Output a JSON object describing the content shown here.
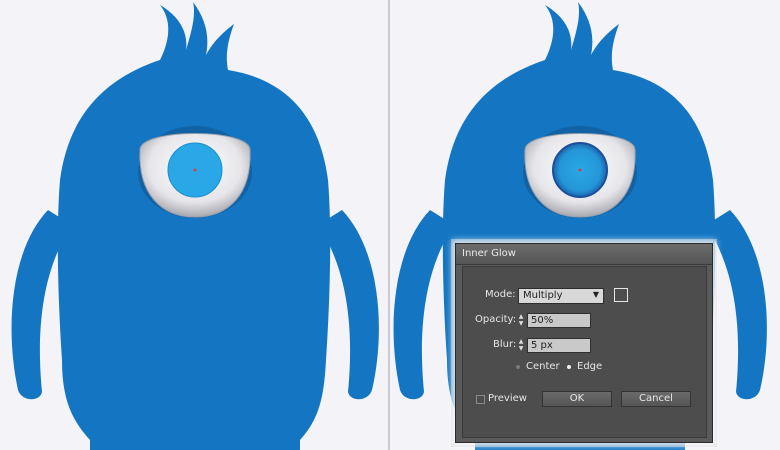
{
  "dialog": {
    "title": "Inner Glow",
    "mode_label": "Mode:",
    "mode_value": "Multiply",
    "opacity_label": "Opacity:",
    "opacity_value": "50%",
    "blur_label": "Blur:",
    "blur_value": "5 px",
    "center_label": "Center",
    "edge_label": "Edge",
    "selected_option": "Edge",
    "preview_label": "Preview",
    "preview_checked": false,
    "ok_label": "OK",
    "cancel_label": "Cancel"
  },
  "colors": {
    "monster_blue": "#1476c2",
    "eye_white": "#eeeeee",
    "iris": "#2aa7e6",
    "iris_stroke_right": "#1d4f9a",
    "background": "#f4f4f8"
  },
  "icons": {
    "mode_dropdown": "chevron-down-icon",
    "opacity_spinner": "spinner-arrows-icon",
    "blur_spinner": "spinner-arrows-icon"
  }
}
